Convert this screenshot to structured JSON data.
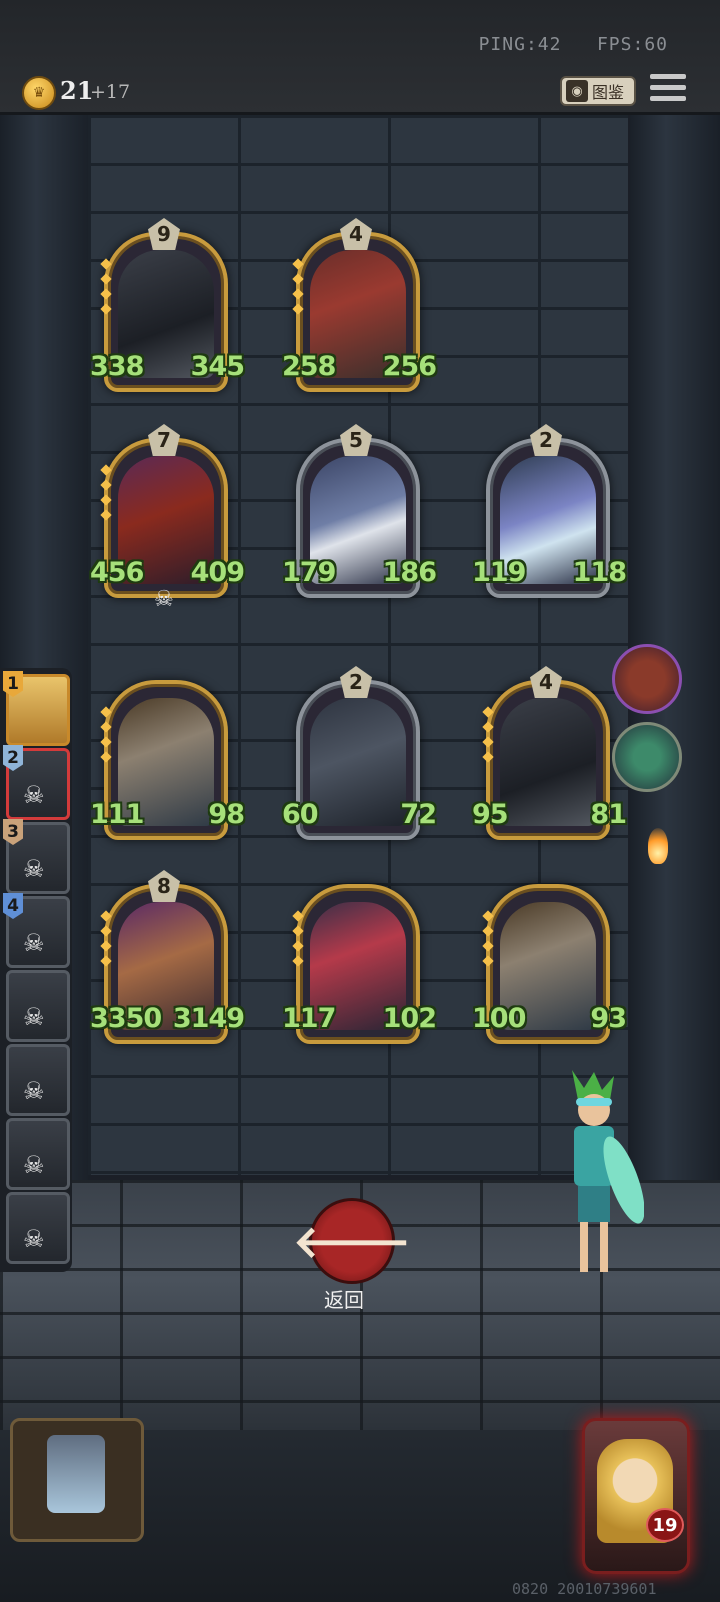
{
  "status": {
    "ping": "PING:42",
    "fps": "FPS:60"
  },
  "economy": {
    "gold": "21",
    "income": "+17"
  },
  "codex_label": "图鉴",
  "back_label": "返回",
  "back_glyph": "🡐",
  "build_id": "0820 20010739601",
  "hero": {
    "level": "19"
  },
  "board": [
    {
      "tier": "9",
      "attack": "338",
      "health": "345",
      "frame": "gold",
      "art": "a1"
    },
    {
      "tier": "4",
      "attack": "258",
      "health": "256",
      "frame": "gold",
      "art": "a2"
    },
    {
      "tier": "7",
      "attack": "456",
      "health": "409",
      "frame": "gold",
      "art": "a3"
    },
    {
      "tier": "5",
      "attack": "179",
      "health": "186",
      "frame": "silver",
      "art": "a4"
    },
    {
      "tier": "2",
      "attack": "119",
      "health": "118",
      "frame": "silver",
      "art": "a5"
    },
    {
      "tier": "",
      "attack": "111",
      "health": "98",
      "frame": "gold",
      "art": "a6"
    },
    {
      "tier": "2",
      "attack": "60",
      "health": "72",
      "frame": "silver",
      "art": "a7"
    },
    {
      "tier": "4",
      "attack": "95",
      "health": "81",
      "frame": "gold",
      "art": "a1"
    },
    {
      "tier": "8",
      "attack": "3350",
      "health": "3149",
      "frame": "gold",
      "art": "a8"
    },
    {
      "tier": "",
      "attack": "117",
      "health": "102",
      "frame": "gold",
      "art": "a9"
    },
    {
      "tier": "",
      "attack": "100",
      "health": "93",
      "frame": "gold",
      "art": "a6"
    }
  ],
  "players": [
    {
      "rank": "1",
      "rank_color": "#e8a83a"
    },
    {
      "rank": "2",
      "rank_color": "#8fb4d8"
    },
    {
      "rank": "3",
      "rank_color": "#c9a27a"
    },
    {
      "rank": "4",
      "rank_color": "#5f8fd6"
    },
    {
      "rank": "",
      "rank_color": ""
    },
    {
      "rank": "",
      "rank_color": ""
    },
    {
      "rank": "",
      "rank_color": ""
    },
    {
      "rank": "",
      "rank_color": ""
    }
  ],
  "icons": {
    "coin": "crown-coin-icon",
    "codex": "book-icon",
    "menu": "hamburger-menu-icon",
    "skull": "☠"
  }
}
